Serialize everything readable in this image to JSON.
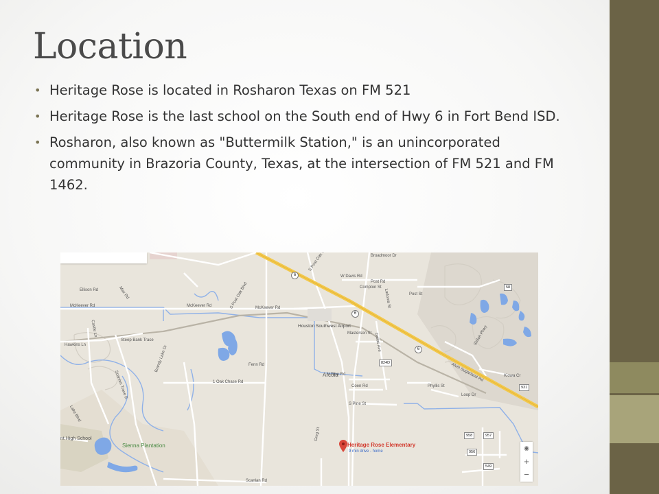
{
  "slide": {
    "title": "Location",
    "bullets": [
      "Heritage Rose is located in Rosharon Texas on FM 521",
      "Heritage Rose is the last school  on  the South end of Hwy 6 in Fort Bend ISD.",
      "Rosharon, also known as \"Buttermilk Station,\" is an unincorporated community in Brazoria County, Texas, at the intersection of FM 521 and FM 1462."
    ]
  },
  "theme": {
    "sidebar_color": "#6b6346",
    "sidebar_band_1": "#8e8a5f",
    "sidebar_band_2": "#a8a47a",
    "title_color": "#4a4a4a",
    "bullet_color": "#7a7353"
  },
  "map": {
    "marker": {
      "title": "Heritage Rose Elementary",
      "subtitle": "9 min drive - home"
    },
    "place_labels": {
      "airport": "Houston Southwest Airport",
      "arcola": "Arcola",
      "sienna": "Sienna Plantation",
      "high_school": "nt High School"
    },
    "roads": {
      "broadmoor": "Broadmoor Dr",
      "w_davis": "W Davis Rd",
      "post_rd": "Post Rd",
      "post_st": "Post St",
      "ellison": "Ellison Rd",
      "max_rd": "Max Rd",
      "s_post_oak_top": "S Post Oak Blvd",
      "s_post_oak_mid": "S Post Oak Blvd",
      "mckeever_1": "McKeever Rd",
      "mckeever_2": "McKeever Rd",
      "mckeever_3": "McKeever Rd",
      "compton": "Compton St",
      "ladonia": "Ladonia St",
      "masterson": "Masterson St",
      "dallas_ave": "Dallas Ave",
      "hawkins": "Hawkins Ln",
      "castle": "Castle Ln",
      "steep_bank": "Steep Bank Trace",
      "fenn": "Fenn Rd",
      "oak_chase": "1 Oak Chase Rd",
      "n_pine": "N Pine Rd",
      "coen": "Coen Rd",
      "s_pine": "S Pine St",
      "scanlan_trace": "Scanlan Trace E",
      "lake_blvd": "Lake Blvd",
      "greg_st": "Greg St",
      "scanlan_rd": "Scanlan Rd",
      "phyllis": "Phyllis St",
      "loop_dr": "Loop Dr",
      "kiowa": "Kiowa Cr",
      "alvin_sugarland": "Alvin Sugarland Rd",
      "shiloh": "Shiloh Pkwy",
      "brandy": "Brandy Lake Dr"
    },
    "shields": {
      "hwy6_a": "6",
      "hwy6_b": "6",
      "hwy6_c": "6",
      "fm58": "58",
      "fm931": "931",
      "fm958": "958",
      "fm957": "957",
      "fm956": "956",
      "fm549": "549",
      "fm824": "824D"
    },
    "zoom": {
      "location": "◉",
      "plus": "+",
      "minus": "−"
    }
  }
}
